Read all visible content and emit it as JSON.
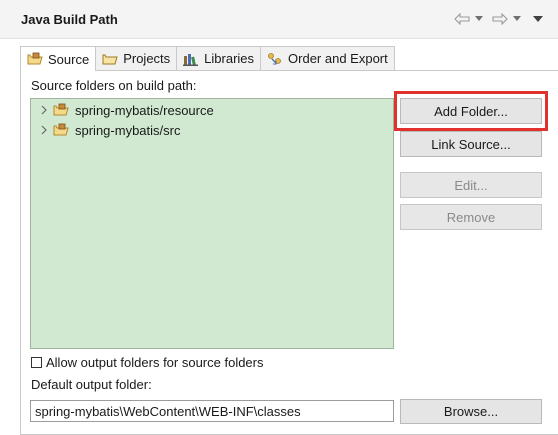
{
  "page": {
    "title": "Java Build Path"
  },
  "nav": {
    "back_icon": "back-arrow-icon",
    "forward_icon": "forward-arrow-icon"
  },
  "tabs": [
    {
      "label": "Source",
      "icon": "source-folder-icon",
      "active": true
    },
    {
      "label": "Projects",
      "icon": "projects-folder-icon",
      "active": false
    },
    {
      "label": "Libraries",
      "icon": "libraries-icon",
      "active": false
    },
    {
      "label": "Order and Export",
      "icon": "order-export-icon",
      "active": false
    }
  ],
  "source": {
    "section_label": "Source folders on build path:",
    "folders": [
      {
        "label": "spring-mybatis/resource",
        "icon": "package-folder-icon"
      },
      {
        "label": "spring-mybatis/src",
        "icon": "package-folder-icon"
      }
    ]
  },
  "buttons": {
    "add_folder": "Add Folder...",
    "link_source": "Link Source...",
    "edit": "Edit...",
    "remove": "Remove",
    "browse": "Browse..."
  },
  "options": {
    "allow_output_label": "Allow output folders for source folders",
    "allow_output_checked": false
  },
  "output": {
    "label": "Default output folder:",
    "value": "spring-mybatis\\WebContent\\WEB-INF\\classes"
  },
  "colors": {
    "tree_background": "#d1e9d1",
    "highlight": "#e0312f"
  }
}
